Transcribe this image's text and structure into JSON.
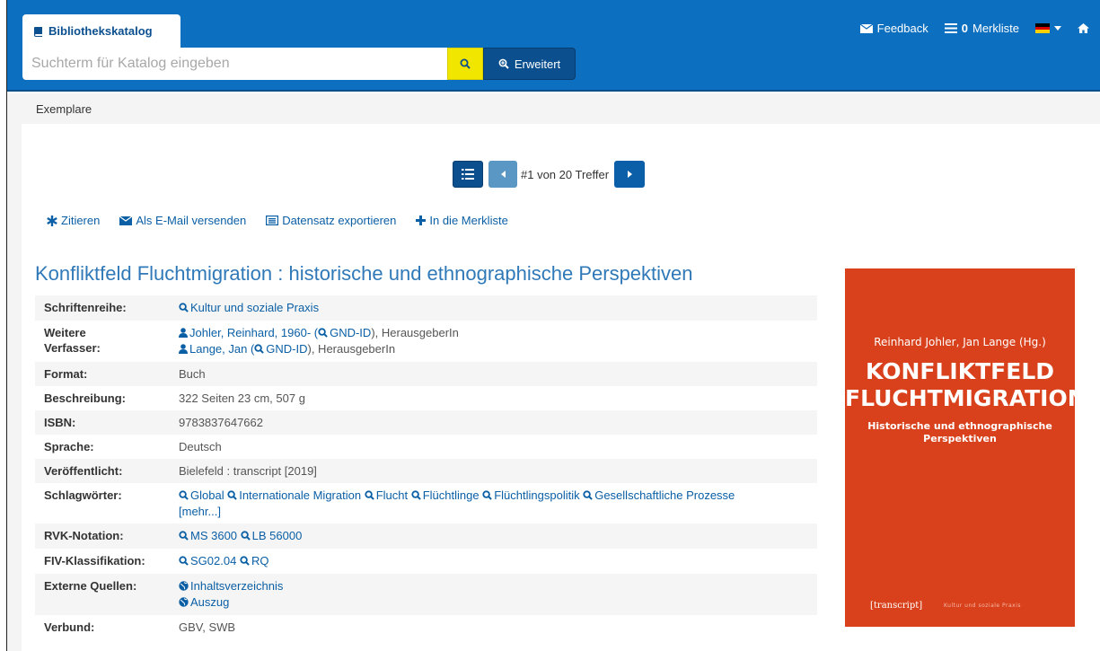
{
  "header": {
    "brand": "Bibliothekskatalog",
    "search_placeholder": "Suchterm für Katalog eingeben",
    "advanced_label": "Erweitert",
    "nav": {
      "feedback": "Feedback",
      "watchlist_count": "0",
      "watchlist_label": "Merkliste"
    }
  },
  "breadcrumb": "Exemplare",
  "pager": {
    "text": "#1 von 20 Treffer"
  },
  "actions": {
    "cite": "Zitieren",
    "email": "Als E-Mail versenden",
    "export": "Datensatz exportieren",
    "add": "In die Merkliste"
  },
  "record": {
    "title": "Konfliktfeld Fluchtmigration : historische und ethnographische Perspektiven",
    "rows": {
      "series_label": "Schriftenreihe:",
      "series_value": "Kultur und soziale Praxis",
      "authors_label_1": "Weitere",
      "authors_label_2": "Verfasser:",
      "author1_name": "Johler, Reinhard, 1960- (",
      "author1_gnd": "GND-ID",
      "author1_role": "), HerausgeberIn",
      "author2_name": "Lange, Jan (",
      "author2_gnd": "GND-ID",
      "author2_role": "), HerausgeberIn",
      "format_label": "Format:",
      "format_value": "Buch",
      "desc_label": "Beschreibung:",
      "desc_value": "322 Seiten 23 cm, 507 g",
      "isbn_label": "ISBN:",
      "isbn_value": "9783837647662",
      "lang_label": "Sprache:",
      "lang_value": "Deutsch",
      "pub_label": "Veröffentlicht:",
      "pub_value": "Bielefeld : transcript [2019]",
      "subj_label": "Schlagwörter:",
      "subjects": [
        "Global",
        "Internationale Migration",
        "Flucht",
        "Flüchtlinge",
        "Flüchtlingspolitik",
        "Gesellschaftliche Prozesse"
      ],
      "subj_more": "[mehr...]",
      "rvk_label": "RVK-Notation:",
      "rvk": [
        "MS 3600",
        "LB 56000"
      ],
      "fiv_label": "FIV-Klassifikation:",
      "fiv": [
        "SG02.04",
        "RQ"
      ],
      "ext_label": "Externe Quellen:",
      "ext": [
        "Inhaltsverzeichnis",
        "Auszug"
      ],
      "verbund_label": "Verbund:",
      "verbund_value": "GBV, SWB"
    }
  },
  "cover": {
    "authors": "Reinhard Johler, Jan Lange (Hg.)",
    "title_line1": "KONFLIKTFELD",
    "title_line2": "FLUCHTMIGRATION",
    "subtitle_line1": "Historische und ethnographische",
    "subtitle_line2": "Perspektiven",
    "publisher": "[transcript]",
    "series": "Kultur und soziale Praxis"
  },
  "colors": {
    "header": "#0d6fbf",
    "link": "#0b5fa5",
    "title": "#3079b8",
    "cover": "#d8411b",
    "search_button": "#f0e600"
  }
}
